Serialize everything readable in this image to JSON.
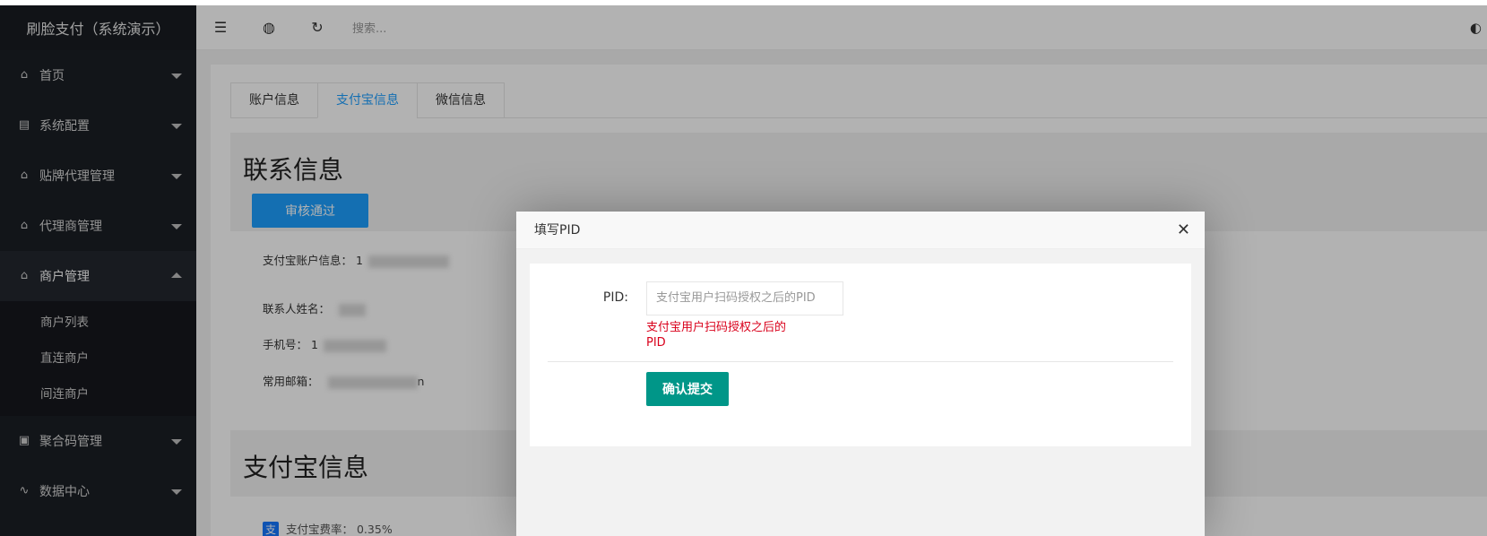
{
  "app": {
    "title": "刷脸支付（系统演示）"
  },
  "sidebar": {
    "items": [
      {
        "label": "首页",
        "icon": "home-icon"
      },
      {
        "label": "系统配置",
        "icon": "settings-icon"
      },
      {
        "label": "贴牌代理管理",
        "icon": "home-icon"
      },
      {
        "label": "代理商管理",
        "icon": "home-icon"
      },
      {
        "label": "商户管理",
        "icon": "home-icon",
        "open": true
      },
      {
        "label": "聚合码管理",
        "icon": "qrcode-icon"
      },
      {
        "label": "数据中心",
        "icon": "chart-pulse-icon"
      }
    ],
    "submenu": [
      "商户列表",
      "直连商户",
      "间连商户"
    ]
  },
  "header": {
    "search_placeholder": "搜索..."
  },
  "tabs": [
    {
      "label": "账户信息",
      "active": false
    },
    {
      "label": "支付宝信息",
      "active": true
    },
    {
      "label": "微信信息",
      "active": false
    }
  ],
  "contact": {
    "title": "联系信息",
    "approve_label": "审核通过",
    "fields": [
      {
        "label": "支付宝账户信息：",
        "value": "1"
      },
      {
        "label": "联系人姓名：",
        "value": ""
      },
      {
        "label": "手机号：",
        "value": "1"
      },
      {
        "label": "常用邮箱：",
        "value": "n"
      }
    ]
  },
  "alipay": {
    "title": "支付宝信息",
    "rate_label": "支付宝费率：",
    "rate_value": "0.35%",
    "badge": "支"
  },
  "modal": {
    "title": "填写PID",
    "pid_label": "PID:",
    "pid_placeholder": "支付宝用户扫码授权之后的PID",
    "error_line1": "支付宝用户扫码授权之后的",
    "error_line2": "PID",
    "submit_label": "确认提交"
  },
  "colors": {
    "primary": "#1e9fff",
    "submit": "#009688",
    "error": "#d9001b",
    "sidebar": "#1b1f25"
  }
}
